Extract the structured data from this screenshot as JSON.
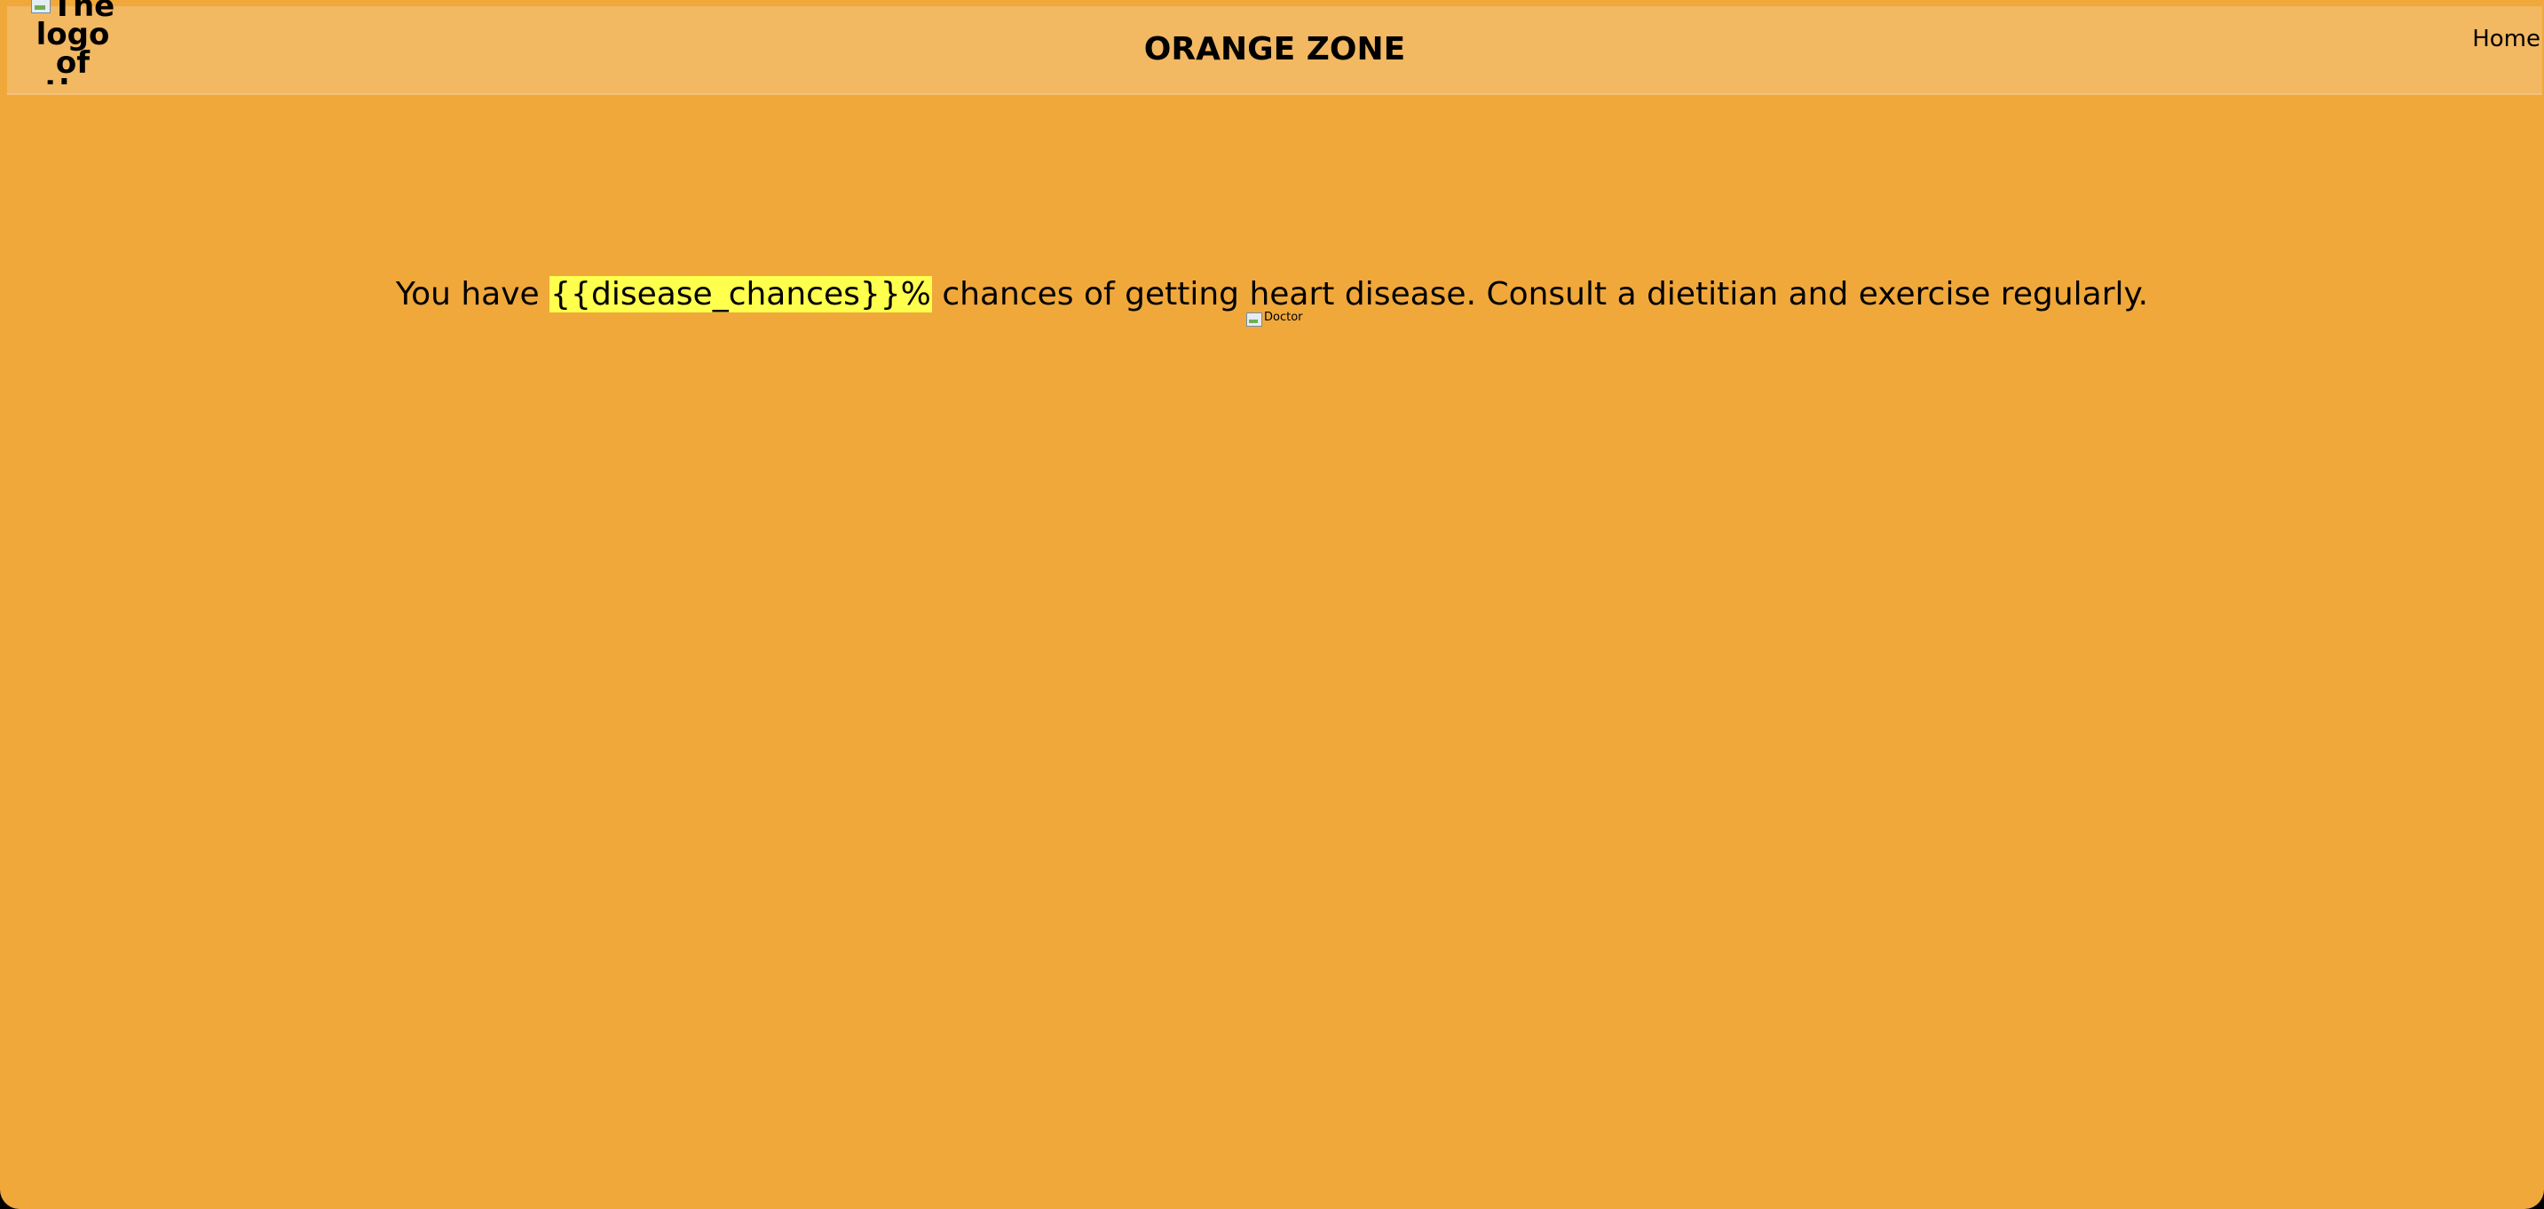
{
  "header": {
    "logo_alt": "The logo of the website",
    "title": "ORANGE ZONE",
    "nav_home": "Home"
  },
  "main": {
    "message_prefix": "You have",
    "message_highlight": "{{disease_chances}}%",
    "message_suffix": "chances of getting heart disease. Consult a dietitian and exercise regularly.",
    "doctor_image_alt": "Doctor"
  },
  "colors": {
    "background": "#f0a83b",
    "header_background": "#f2b862",
    "highlight": "#ffff4d"
  }
}
